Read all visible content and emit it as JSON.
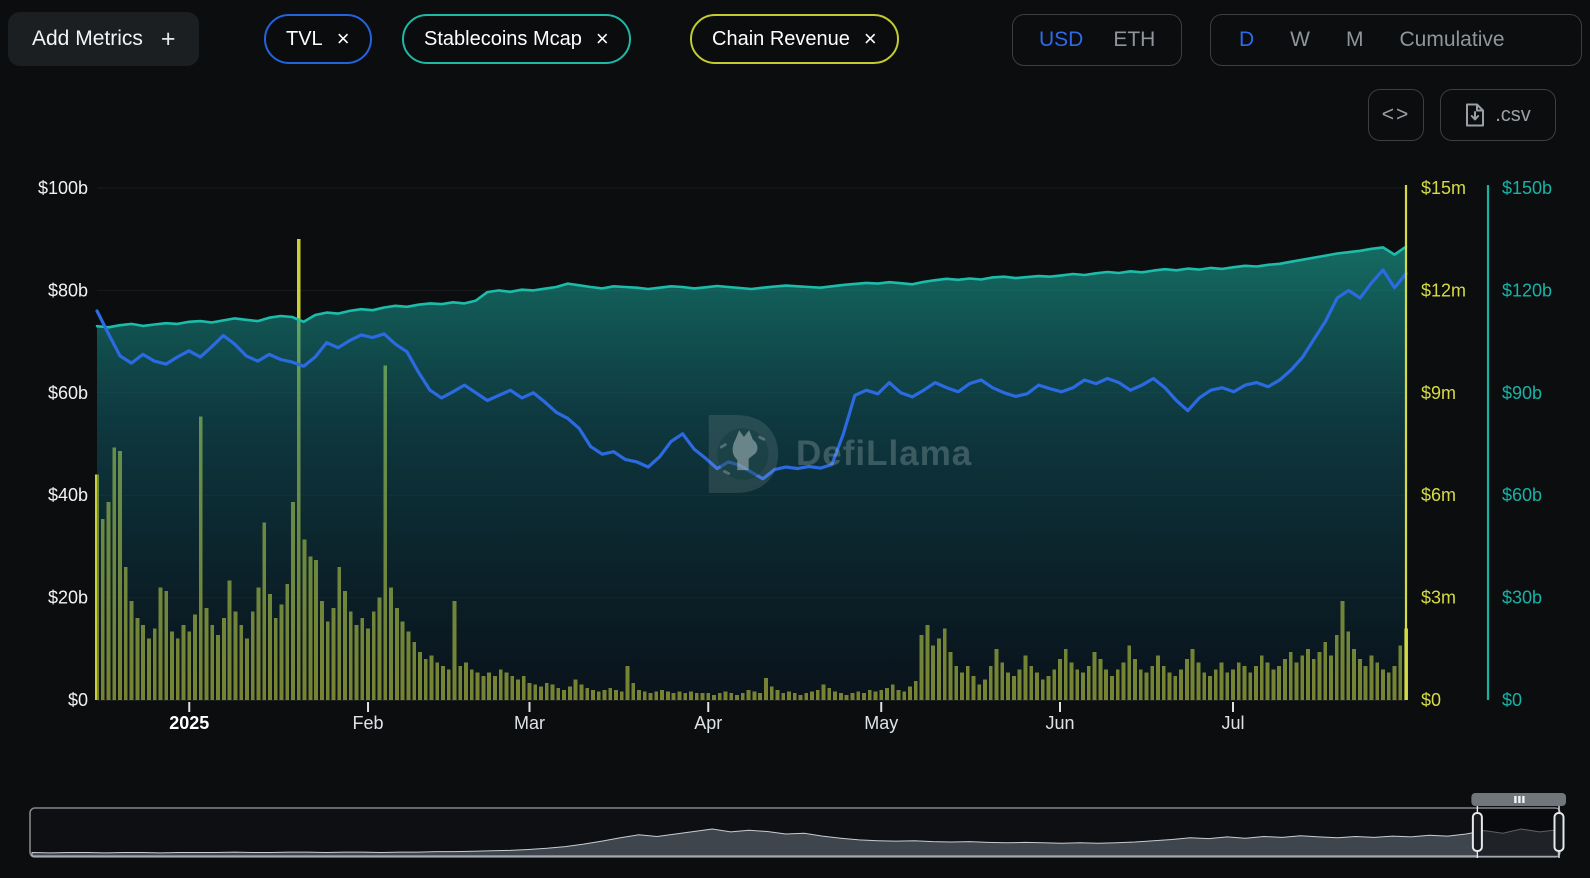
{
  "theme": {
    "bg": "#0b0d0f",
    "accent_blue": "#2e6ae8",
    "button_bg": "#1c1f22",
    "muted_text": "#9aa0a6",
    "grid_color": "rgba(255,255,255,0.06)"
  },
  "toolbar": {
    "add_metrics_label": "Add Metrics",
    "plus_glyph": "+",
    "close_glyph": "×",
    "metric_tags": [
      {
        "label": "TVL",
        "color": "#2463e0"
      },
      {
        "label": "Stablecoins Mcap",
        "color": "#1fb7a5"
      },
      {
        "label": "Chain Revenue",
        "color": "#c3cc2e"
      }
    ],
    "currency": [
      "USD",
      "ETH"
    ],
    "currency_active": "USD",
    "intervals": [
      "D",
      "W",
      "M",
      "Cumulative"
    ],
    "interval_active": "D",
    "embed_glyph": "<>",
    "csv_label": ".csv"
  },
  "watermark": {
    "text": "DefiLlama"
  },
  "chart_data": {
    "type": "mixed",
    "title": "",
    "x_start": "2024-12-16",
    "x_end": "2025-07-31",
    "days_total": 228,
    "grid": "horizontal-faint",
    "x_ticks": [
      {
        "label": "2025",
        "day": 16,
        "bold": true
      },
      {
        "label": "Feb",
        "day": 47,
        "bold": false
      },
      {
        "label": "Mar",
        "day": 75,
        "bold": false
      },
      {
        "label": "Apr",
        "day": 106,
        "bold": false
      },
      {
        "label": "May",
        "day": 136,
        "bold": false
      },
      {
        "label": "Jun",
        "day": 167,
        "bold": false
      },
      {
        "label": "Jul",
        "day": 197,
        "bold": false
      }
    ],
    "axes": {
      "left": {
        "labels": [
          "$0",
          "$20b",
          "$40b",
          "$60b",
          "$80b",
          "$100b"
        ],
        "max": 100,
        "unit": "USD billions",
        "color": "#f0f2f4"
      },
      "right_revenue": {
        "labels": [
          "$0",
          "$3m",
          "$6m",
          "$9m",
          "$12m",
          "$15m"
        ],
        "max": 15,
        "unit": "USD millions",
        "color": "#d6db43"
      },
      "right_stable": {
        "labels": [
          "$0",
          "$30b",
          "$60b",
          "$90b",
          "$120b",
          "$150b"
        ],
        "max": 150,
        "unit": "USD billions",
        "color": "#16b3a6"
      }
    },
    "series": [
      {
        "name": "TVL",
        "type": "line",
        "axis": "left",
        "color": "#2b6ae0",
        "unit": "$b",
        "step_days": 2,
        "values": [
          76.0,
          71.5,
          67.2,
          65.8,
          67.5,
          66.2,
          65.6,
          67.0,
          68.2,
          67.0,
          69.0,
          71.2,
          69.5,
          67.2,
          66.2,
          67.5,
          66.5,
          66.0,
          65.2,
          67.0,
          69.8,
          68.8,
          70.2,
          71.3,
          70.8,
          71.5,
          69.5,
          68.0,
          64.0,
          60.5,
          59.0,
          60.2,
          61.5,
          60.0,
          58.5,
          59.5,
          60.5,
          59.0,
          60.0,
          58.2,
          56.2,
          55.0,
          53.0,
          49.5,
          48.0,
          48.5,
          47.0,
          46.5,
          45.5,
          47.5,
          50.5,
          52.0,
          49.0,
          47.2,
          45.2,
          46.5,
          45.8,
          44.5,
          43.2,
          45.0,
          45.5,
          45.2,
          45.6,
          45.3,
          46.0,
          52.0,
          59.5,
          60.5,
          59.8,
          62.0,
          60.0,
          59.2,
          60.5,
          62.0,
          61.0,
          60.2,
          61.8,
          62.5,
          61.0,
          60.0,
          59.3,
          59.8,
          61.5,
          60.8,
          60.2,
          61.0,
          62.5,
          61.8,
          62.8,
          62.0,
          60.5,
          61.5,
          62.8,
          61.0,
          58.5,
          56.5,
          59.0,
          60.5,
          61.0,
          60.2,
          61.5,
          62.0,
          61.2,
          62.5,
          64.5,
          67.0,
          70.5,
          74.0,
          78.5,
          80.0,
          78.5,
          81.5,
          84.0,
          80.5,
          83.3
        ]
      },
      {
        "name": "Stablecoins Mcap",
        "type": "area",
        "axis": "right_stable",
        "color": "#1cbcaa",
        "unit": "$b",
        "step_days": 2,
        "values": [
          109.5,
          109.2,
          109.8,
          110.2,
          109.6,
          110.0,
          110.4,
          110.2,
          110.8,
          111.0,
          110.6,
          111.2,
          111.8,
          111.4,
          111.0,
          112.0,
          112.5,
          112.2,
          110.8,
          112.8,
          113.5,
          113.2,
          114.0,
          114.5,
          114.2,
          115.0,
          115.5,
          115.2,
          115.8,
          116.2,
          116.0,
          116.5,
          116.2,
          117.0,
          119.5,
          120.0,
          119.6,
          120.2,
          120.0,
          120.5,
          121.0,
          122.0,
          121.5,
          121.0,
          120.6,
          121.2,
          121.0,
          120.8,
          120.4,
          120.8,
          121.2,
          121.0,
          120.6,
          120.9,
          121.3,
          121.0,
          120.7,
          120.4,
          120.8,
          121.1,
          121.4,
          121.2,
          121.0,
          120.8,
          121.2,
          121.6,
          121.9,
          122.2,
          122.0,
          122.4,
          122.1,
          121.8,
          122.5,
          123.0,
          123.4,
          123.1,
          123.5,
          123.2,
          123.8,
          124.0,
          123.6,
          123.9,
          124.2,
          124.0,
          124.4,
          124.8,
          124.5,
          125.0,
          125.4,
          125.1,
          125.6,
          125.3,
          125.8,
          126.2,
          125.9,
          126.4,
          126.1,
          126.6,
          126.3,
          126.8,
          127.2,
          127.0,
          127.5,
          127.8,
          128.4,
          129.0,
          129.6,
          130.2,
          130.8,
          131.2,
          131.6,
          132.2,
          132.6,
          130.5,
          132.8
        ]
      },
      {
        "name": "Chain Revenue",
        "type": "bar",
        "axis": "right_revenue",
        "color": "#c9cf35",
        "unit": "$m",
        "step_days": 1,
        "values": [
          6.6,
          5.3,
          5.8,
          7.4,
          7.3,
          3.9,
          2.9,
          2.4,
          2.2,
          1.8,
          2.1,
          3.3,
          3.2,
          2.0,
          1.8,
          2.2,
          2.0,
          2.5,
          8.3,
          2.7,
          2.2,
          1.9,
          2.4,
          3.5,
          2.6,
          2.2,
          1.8,
          2.6,
          3.3,
          5.2,
          3.1,
          2.4,
          2.8,
          3.4,
          5.8,
          13.5,
          4.7,
          4.2,
          4.1,
          2.9,
          2.3,
          2.7,
          3.9,
          3.2,
          2.6,
          2.2,
          2.4,
          2.1,
          2.6,
          3.0,
          9.8,
          3.3,
          2.7,
          2.3,
          2.0,
          1.7,
          1.4,
          1.2,
          1.3,
          1.1,
          1.0,
          0.9,
          2.9,
          1.0,
          1.1,
          0.9,
          0.8,
          0.7,
          0.8,
          0.7,
          0.9,
          0.8,
          0.7,
          0.6,
          0.7,
          0.5,
          0.45,
          0.4,
          0.5,
          0.45,
          0.35,
          0.3,
          0.4,
          0.6,
          0.45,
          0.35,
          0.3,
          0.25,
          0.3,
          0.35,
          0.3,
          0.25,
          1.0,
          0.5,
          0.3,
          0.25,
          0.2,
          0.25,
          0.3,
          0.25,
          0.2,
          0.25,
          0.2,
          0.25,
          0.2,
          0.2,
          0.2,
          0.15,
          0.2,
          0.25,
          0.2,
          0.15,
          0.2,
          0.3,
          0.25,
          0.2,
          0.65,
          0.4,
          0.3,
          0.2,
          0.25,
          0.2,
          0.15,
          0.2,
          0.25,
          0.3,
          0.45,
          0.35,
          0.25,
          0.2,
          0.15,
          0.2,
          0.25,
          0.2,
          0.3,
          0.25,
          0.3,
          0.35,
          0.45,
          0.3,
          0.25,
          0.4,
          0.55,
          1.9,
          2.2,
          1.6,
          1.8,
          2.1,
          1.4,
          1.0,
          0.8,
          1.0,
          0.7,
          0.45,
          0.6,
          1.0,
          1.5,
          1.1,
          0.8,
          0.7,
          0.9,
          1.3,
          1.0,
          0.8,
          0.6,
          0.7,
          0.9,
          1.2,
          1.5,
          1.1,
          0.9,
          0.8,
          1.0,
          1.4,
          1.2,
          0.9,
          0.7,
          0.9,
          1.1,
          1.6,
          1.2,
          0.9,
          0.8,
          1.0,
          1.3,
          1.0,
          0.8,
          0.7,
          0.9,
          1.2,
          1.5,
          1.1,
          0.8,
          0.7,
          0.9,
          1.1,
          0.8,
          0.9,
          1.1,
          1.0,
          0.8,
          1.0,
          1.3,
          1.1,
          0.9,
          1.0,
          1.2,
          1.4,
          1.1,
          1.3,
          1.5,
          1.2,
          1.4,
          1.7,
          1.3,
          1.9,
          2.9,
          2.0,
          1.5,
          1.2,
          1.0,
          1.3,
          1.1,
          0.9,
          0.8,
          1.0,
          1.6,
          2.1
        ]
      }
    ],
    "navigator": {
      "description": "full-history thumbnail with zoom window at far right",
      "selection_start_frac": 0.946,
      "selection_end_frac": 1.0,
      "values": [
        0.06,
        0.05,
        0.06,
        0.06,
        0.05,
        0.06,
        0.06,
        0.05,
        0.06,
        0.06,
        0.06,
        0.07,
        0.06,
        0.06,
        0.07,
        0.07,
        0.06,
        0.07,
        0.07,
        0.06,
        0.07,
        0.07,
        0.08,
        0.08,
        0.09,
        0.1,
        0.11,
        0.13,
        0.16,
        0.2,
        0.26,
        0.33,
        0.41,
        0.48,
        0.44,
        0.5,
        0.56,
        0.62,
        0.55,
        0.59,
        0.56,
        0.5,
        0.52,
        0.45,
        0.4,
        0.36,
        0.34,
        0.33,
        0.34,
        0.32,
        0.31,
        0.32,
        0.3,
        0.29,
        0.3,
        0.29,
        0.28,
        0.29,
        0.28,
        0.29,
        0.31,
        0.34,
        0.37,
        0.41,
        0.39,
        0.43,
        0.4,
        0.44,
        0.42,
        0.46,
        0.43,
        0.41,
        0.44,
        0.42,
        0.45,
        0.43,
        0.47,
        0.45,
        0.5,
        0.58,
        0.52,
        0.62,
        0.55,
        0.6
      ]
    }
  }
}
